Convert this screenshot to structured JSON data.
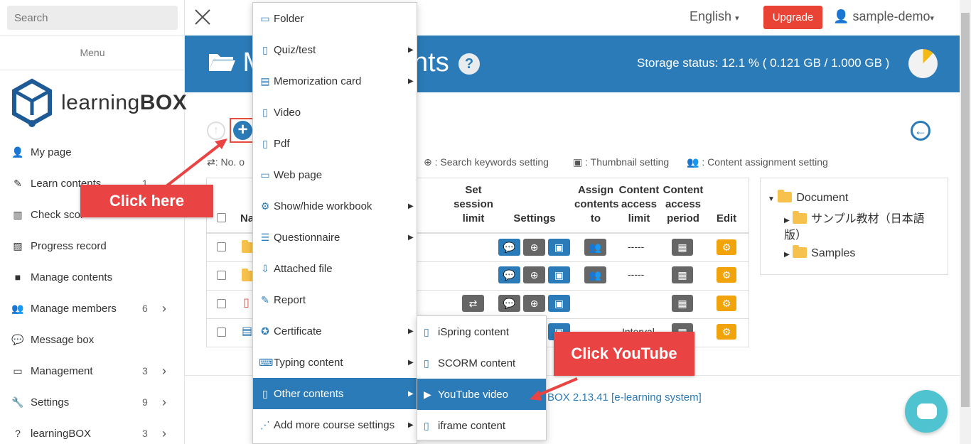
{
  "sidebar": {
    "search_placeholder": "Search",
    "menu_title": "Menu",
    "logo": {
      "text_light": "learning",
      "text_bold": "BOX"
    },
    "items": [
      {
        "label": "My page",
        "icon": "user-icon",
        "count": "",
        "chevron": false
      },
      {
        "label": "Learn contents",
        "icon": "pencil-icon",
        "count": "1",
        "chevron": false
      },
      {
        "label": "Check scor",
        "icon": "bar-chart-icon",
        "count": "",
        "chevron": false
      },
      {
        "label": "Progress record",
        "icon": "progress-chart-icon",
        "count": "",
        "chevron": false
      },
      {
        "label": "Manage contents",
        "icon": "folder-icon",
        "count": "",
        "chevron": false
      },
      {
        "label": "Manage members",
        "icon": "users-icon",
        "count": "6",
        "chevron": true
      },
      {
        "label": "Message box",
        "icon": "comments-icon",
        "count": "",
        "chevron": false
      },
      {
        "label": "Management",
        "icon": "desktop-icon",
        "count": "3",
        "chevron": true
      },
      {
        "label": "Settings",
        "icon": "wrench-icon",
        "count": "9",
        "chevron": true
      },
      {
        "label": "learningBOX",
        "icon": "question-icon",
        "count": "3",
        "chevron": true
      }
    ]
  },
  "topbar": {
    "language": "English",
    "upgrade_label": "Upgrade",
    "user_name": "sample-demo"
  },
  "header": {
    "title": "Manage contents",
    "title_visible_left": "M",
    "title_visible_right": "nts",
    "help_label": "?",
    "storage_status": "Storage status: 12.1 % ( 0.121 GB / 1.000 GB )",
    "storage_fraction": 0.121,
    "pie_color": "#f5b914"
  },
  "legend": {
    "loop_text": ": No. o",
    "search_text": ": Search keywords setting",
    "thumb_text": ": Thumbnail setting",
    "assign_text": ": Content assignment setting"
  },
  "table": {
    "headers": {
      "name": "Na",
      "session": "Set session limit",
      "settings": "Settings",
      "assign": "Assign contents to",
      "access_limit": "Content access limit",
      "access_period": "Content access period",
      "edit": "Edit"
    },
    "row_values": {
      "dash": "-----",
      "interval_partial": "Interval"
    }
  },
  "tree": {
    "root": "Document",
    "children": [
      "サンプル教材（日本語版）",
      "Samples"
    ]
  },
  "footer_text": "BOX 2.13.41 [e-learning system]",
  "dropdown": {
    "items": [
      {
        "label": "Folder",
        "icon": "folder-outline-icon",
        "arrow": false
      },
      {
        "label": "Quiz/test",
        "icon": "file-icon",
        "arrow": true
      },
      {
        "label": "Memorization card",
        "icon": "cards-icon",
        "arrow": true
      },
      {
        "label": "Video",
        "icon": "file-video-icon",
        "arrow": false
      },
      {
        "label": "Pdf",
        "icon": "file-pdf-icon",
        "arrow": false
      },
      {
        "label": "Web page",
        "icon": "window-icon",
        "arrow": false
      },
      {
        "label": "Show/hide workbook",
        "icon": "workbook-icon",
        "arrow": true
      },
      {
        "label": "Questionnaire",
        "icon": "list-icon",
        "arrow": true
      },
      {
        "label": "Attached file",
        "icon": "file-download-icon",
        "arrow": false
      },
      {
        "label": "Report",
        "icon": "file-edit-icon",
        "arrow": false
      },
      {
        "label": "Certificate",
        "icon": "certificate-icon",
        "arrow": true
      },
      {
        "label": "Typing content",
        "icon": "keyboard-icon",
        "arrow": true
      },
      {
        "label": "Other contents",
        "icon": "file-icon",
        "arrow": true
      },
      {
        "label": "Add more course settings",
        "icon": "road-icon",
        "arrow": true
      }
    ]
  },
  "submenu": {
    "items": [
      {
        "label": "iSpring content",
        "icon": "file-icon"
      },
      {
        "label": "SCORM content",
        "icon": "file-icon"
      },
      {
        "label": "YouTube video",
        "icon": "youtube-icon"
      },
      {
        "label": "iframe content",
        "icon": "file-icon"
      }
    ]
  },
  "annotations": {
    "click_here": "Click here",
    "click_youtube": "Click YouTube",
    "color": "#e94343"
  },
  "colors": {
    "brand_blue": "#2b7bb8",
    "upgrade_red": "#e94335",
    "edit_orange": "#f0a30a",
    "gray_button": "#666666"
  }
}
